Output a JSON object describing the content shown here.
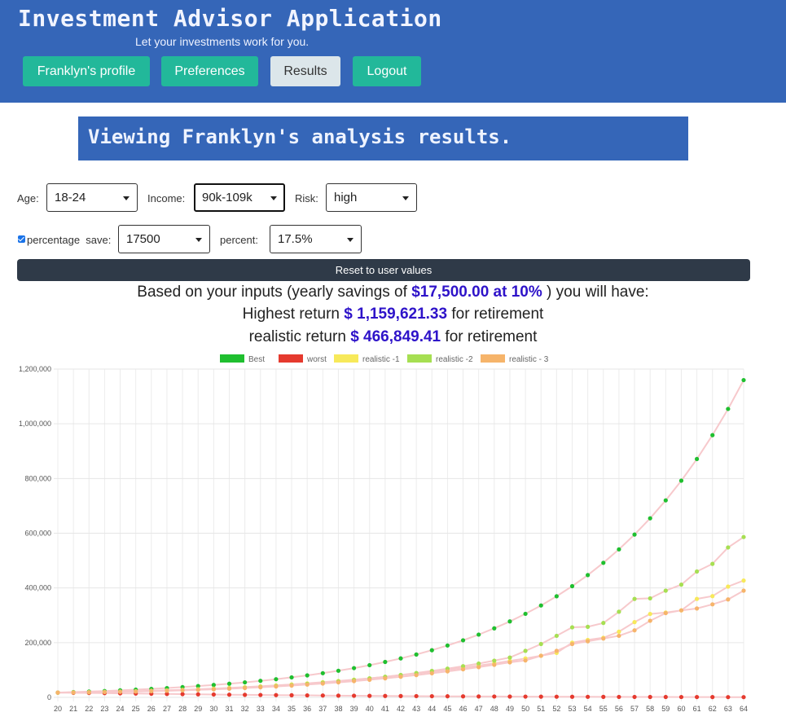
{
  "app": {
    "title": "Investment Advisor Application",
    "subtitle": "Let your investments work for you."
  },
  "nav": {
    "profile": "Franklyn's profile",
    "preferences": "Preferences",
    "results": "Results",
    "logout": "Logout"
  },
  "banner": "Viewing Franklyn's analysis results.",
  "controls": {
    "age_label": "Age:",
    "age_value": "18-24",
    "income_label": "Income:",
    "income_value": "90k-109k",
    "risk_label": "Risk:",
    "risk_value": "high",
    "percentage_save_label": "percentage  save:",
    "percentage_save_checked": true,
    "save_value": "17500",
    "percent_label": "percent:",
    "percent_value": "17.5%",
    "reset_label": "Reset to user values"
  },
  "summary": {
    "line1_prefix": "Based on your inputs (yearly savings of ",
    "line1_highlight": "$17,500.00 at 10%",
    "line1_suffix": " ) you will have:",
    "line2_prefix": "Highest return ",
    "line2_highlight": "$ 1,159,621.33",
    "line2_suffix": " for retirement",
    "line3_prefix": "realistic return ",
    "line3_highlight": "$ 466,849.41",
    "line3_suffix": " for retirement"
  },
  "colors": {
    "header": "#3566b8",
    "nav_button": "#22b89a",
    "nav_active": "#dce6ea",
    "highlight": "#2e13c9",
    "reset": "#2f3a48"
  },
  "chart_data": {
    "type": "line",
    "x": [
      20,
      21,
      22,
      23,
      24,
      25,
      26,
      27,
      28,
      29,
      30,
      31,
      32,
      33,
      34,
      35,
      36,
      37,
      38,
      39,
      40,
      41,
      42,
      43,
      44,
      45,
      46,
      47,
      48,
      49,
      50,
      51,
      52,
      53,
      54,
      55,
      56,
      57,
      58,
      59,
      60,
      61,
      62,
      63,
      64
    ],
    "ylim": [
      0,
      1200000
    ],
    "yticks": [
      0,
      200000,
      400000,
      600000,
      800000,
      1000000,
      1200000
    ],
    "ytick_labels": [
      "0",
      "200,000",
      "400,000",
      "600,000",
      "800,000",
      "1,000,000",
      "1,200,000"
    ],
    "grid": true,
    "legend_position": "top",
    "series": [
      {
        "name": "Best",
        "color": "#1fbf2f",
        "values": [
          17500,
          19250,
          21175,
          23293,
          25622,
          28184,
          31002,
          34103,
          37513,
          41264,
          45391,
          49930,
          54923,
          60415,
          66457,
          73102,
          80412,
          88454,
          97299,
          107029,
          117732,
          129505,
          142456,
          156701,
          172372,
          189609,
          208570,
          229427,
          252369,
          277606,
          305367,
          335904,
          369494,
          406443,
          447088,
          491796,
          540976,
          595074,
          654581,
          720039,
          792043,
          871248,
          958372,
          1054210,
          1159621
        ]
      },
      {
        "name": "worst",
        "color": "#e53a2e",
        "values": [
          17500,
          16800,
          16100,
          15400,
          14700,
          14000,
          13300,
          12600,
          11900,
          11200,
          10500,
          9800,
          9300,
          8800,
          8300,
          7800,
          7300,
          6800,
          6400,
          6000,
          5600,
          5200,
          4900,
          4600,
          4300,
          4000,
          3700,
          3400,
          3200,
          3000,
          2800,
          2600,
          2400,
          2200,
          2000,
          1800,
          1700,
          1600,
          1500,
          1400,
          1300,
          1200,
          1100,
          1000,
          900
        ]
      },
      {
        "name": "realistic -1",
        "color": "#f7e95a",
        "values": [
          17500,
          18300,
          19200,
          20200,
          21300,
          22600,
          24100,
          25800,
          27700,
          29800,
          32100,
          34600,
          37400,
          40400,
          43700,
          47300,
          51200,
          55400,
          59900,
          64700,
          69800,
          75200,
          81000,
          87200,
          93800,
          100800,
          108200,
          116000,
          124300,
          133100,
          142400,
          152200,
          162500,
          200000,
          210000,
          218000,
          240000,
          275000,
          305000,
          310000,
          318000,
          360000,
          370000,
          405000,
          427000
        ]
      },
      {
        "name": "realistic -2",
        "color": "#a6df52",
        "values": [
          17500,
          18200,
          18900,
          19700,
          20600,
          21700,
          23000,
          24500,
          26200,
          28100,
          30200,
          32600,
          35300,
          38300,
          41600,
          45200,
          49200,
          53600,
          58400,
          63600,
          69200,
          75300,
          81900,
          89000,
          96700,
          105000,
          114000,
          123700,
          134200,
          145500,
          170000,
          195000,
          225000,
          256000,
          258000,
          272000,
          313000,
          360000,
          362000,
          390000,
          412000,
          460000,
          488000,
          548000,
          586000
        ]
      },
      {
        "name": "realistic - 3",
        "color": "#f6b46a",
        "values": [
          17500,
          18000,
          18700,
          19500,
          20400,
          21400,
          22600,
          24000,
          25600,
          27400,
          29400,
          31600,
          34100,
          36800,
          39800,
          43100,
          46700,
          50600,
          54800,
          59400,
          64300,
          69600,
          75300,
          81400,
          88000,
          95000,
          102500,
          110500,
          119000,
          128000,
          135000,
          152000,
          170000,
          195000,
          205000,
          215000,
          225000,
          245000,
          280000,
          308000,
          318000,
          325000,
          340000,
          358000,
          390000
        ]
      }
    ]
  }
}
